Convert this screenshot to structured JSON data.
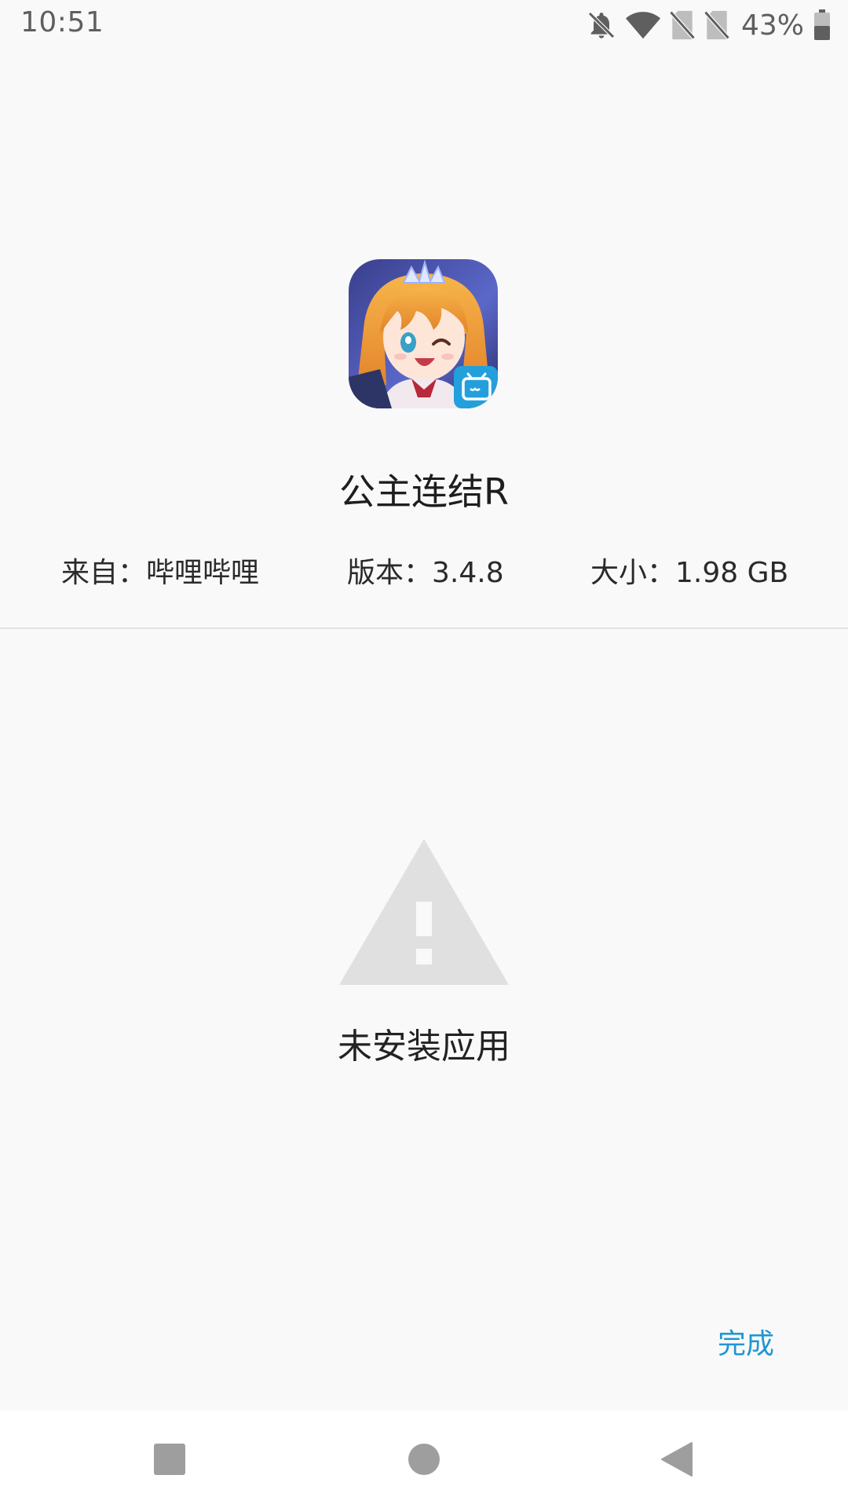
{
  "status_bar": {
    "time": "10:51",
    "battery_percent": "43%",
    "icons": [
      "notifications-off-icon",
      "wifi-icon",
      "no-sim-icon",
      "no-sim-icon",
      "battery-icon"
    ]
  },
  "app": {
    "name": "公主连结R",
    "from": "来自：哔哩哔哩",
    "version": "版本：3.4.8",
    "size": "大小：1.98 GB",
    "icon": "app-icon-anime-character-with-bilibili-badge"
  },
  "result": {
    "icon": "warning-icon",
    "message": "未安装应用"
  },
  "actions": {
    "done_label": "完成"
  },
  "nav_bar": {
    "buttons": [
      "recent-apps-icon",
      "home-icon",
      "back-icon"
    ]
  },
  "colors": {
    "accent": "#2196d3",
    "background": "#f9f9f9",
    "warning_icon": "#e0e0e0"
  }
}
